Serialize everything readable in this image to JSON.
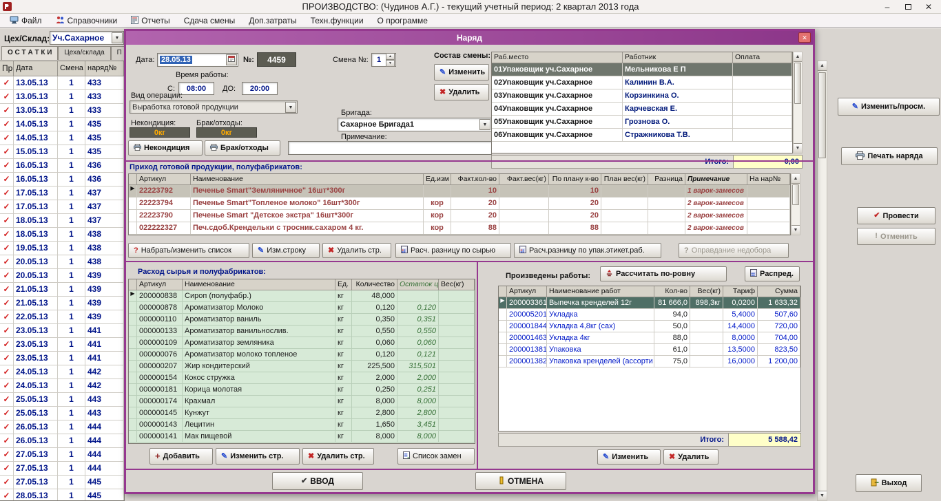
{
  "window": {
    "title": "ПРОИЗВОДСТВО:  (Чудинов А.Г.) - текущий учетный период: 2 квартал 2013 года"
  },
  "icons": {
    "minimize": "–",
    "close": "✕",
    "dialog_close": "✕",
    "check_dark": "✔",
    "check_red": "✔",
    "cross": "✖",
    "pencil": "✎",
    "question": "?",
    "plus": "+",
    "down": "▼",
    "up": "▲",
    "excl": "!"
  },
  "menu": {
    "items": [
      "Файл",
      "Справочники",
      "Отчеты",
      "Сдача смены",
      "Доп.затраты",
      "Техн.функции",
      "О программе"
    ]
  },
  "left_panel": {
    "workshop_label": "Цех/Склад:",
    "workshop_value": "Уч.Сахарное",
    "tabs": [
      "О С Т А Т К И",
      "Цеха/склада",
      "П Р"
    ],
    "columns": [
      "Пр.",
      "Дата",
      "Смена",
      "наряд№"
    ],
    "rows": [
      [
        "✓",
        "13.05.13",
        "1",
        "433"
      ],
      [
        "✓",
        "13.05.13",
        "1",
        "433"
      ],
      [
        "✓",
        "13.05.13",
        "1",
        "433"
      ],
      [
        "✓",
        "14.05.13",
        "1",
        "435"
      ],
      [
        "✓",
        "14.05.13",
        "1",
        "435"
      ],
      [
        "✓",
        "15.05.13",
        "1",
        "435"
      ],
      [
        "✓",
        "16.05.13",
        "1",
        "436"
      ],
      [
        "✓",
        "16.05.13",
        "1",
        "436"
      ],
      [
        "✓",
        "17.05.13",
        "1",
        "437"
      ],
      [
        "✓",
        "17.05.13",
        "1",
        "437"
      ],
      [
        "✓",
        "18.05.13",
        "1",
        "437"
      ],
      [
        "✓",
        "18.05.13",
        "1",
        "438"
      ],
      [
        "✓",
        "19.05.13",
        "1",
        "438"
      ],
      [
        "✓",
        "20.05.13",
        "1",
        "438"
      ],
      [
        "✓",
        "20.05.13",
        "1",
        "439"
      ],
      [
        "✓",
        "21.05.13",
        "1",
        "439"
      ],
      [
        "✓",
        "21.05.13",
        "1",
        "439"
      ],
      [
        "✓",
        "22.05.13",
        "1",
        "439"
      ],
      [
        "✓",
        "23.05.13",
        "1",
        "441"
      ],
      [
        "✓",
        "23.05.13",
        "1",
        "441"
      ],
      [
        "✓",
        "23.05.13",
        "1",
        "441"
      ],
      [
        "✓",
        "24.05.13",
        "1",
        "442"
      ],
      [
        "✓",
        "24.05.13",
        "1",
        "442"
      ],
      [
        "✓",
        "25.05.13",
        "1",
        "443"
      ],
      [
        "✓",
        "25.05.13",
        "1",
        "443"
      ],
      [
        "✓",
        "26.05.13",
        "1",
        "444"
      ],
      [
        "✓",
        "26.05.13",
        "1",
        "444"
      ],
      [
        "✓",
        "27.05.13",
        "1",
        "444"
      ],
      [
        "✓",
        "27.05.13",
        "1",
        "444"
      ],
      [
        "✓",
        "27.05.13",
        "1",
        "445"
      ],
      [
        "✓",
        "28.05.13",
        "1",
        "445"
      ]
    ]
  },
  "dialog": {
    "title": "Наряд",
    "form": {
      "date_label": "Дата:",
      "date_value": "28.05.13",
      "num_label": "№:",
      "num_value": "4459",
      "shift_label": "Смена №:",
      "shift_value": "1",
      "time_label": "Время работы:",
      "time_from_label": "С:",
      "time_from": "08:00",
      "time_to_label": "ДО:",
      "time_to": "20:00",
      "operation_label": "Вид операции:",
      "operation_value": "Выработка готовой продукции",
      "nekond_label": "Некондиция:",
      "nekond_value": "0кг",
      "brak_label": "Брак/отходы:",
      "brak_value": "0кг",
      "nekond_btn": "Некондиция",
      "brak_btn": "Брак/отходы",
      "brigade_label": "Бригада:",
      "brigade_value": "Сахарное Бригада1",
      "note_label": "Примечание:",
      "note_value": ""
    },
    "team": {
      "title": "Состав смены:",
      "edit_btn": "Изменить",
      "delete_btn": "Удалить",
      "columns": [
        "Раб.место",
        "Работник",
        "Оплата"
      ],
      "rows": [
        [
          "01Упаковщик уч.Сахарное",
          "Мельникова Е П",
          ""
        ],
        [
          "02Упаковщик уч.Сахарное",
          "Калинин В.А.",
          ""
        ],
        [
          "03Упаковщик уч.Сахарное",
          "Корзинкина О.",
          ""
        ],
        [
          "04Упаковщик уч.Сахарное",
          "Карчевская Е.",
          ""
        ],
        [
          "05Упаковщик уч.Сахарное",
          "Грознова О.",
          ""
        ],
        [
          "06Упаковщик уч.Сахарное",
          "Стражникова Т.В.",
          ""
        ]
      ],
      "total_label": "Итого:",
      "total_value": "0,00"
    },
    "prihod": {
      "title": "Приход готовой продукции, полуфабрикатов:",
      "columns": [
        "Артикул",
        "Наименование",
        "Ед.изм",
        "Факт.кол-во",
        "Факт.вес(кг)",
        "По плану к-во",
        "План вес(кг)",
        "Разница",
        "Примечание",
        "На нар№"
      ],
      "rows": [
        [
          "22223792",
          "Печенье  Smart\"Земляничное\" 16шт*300г",
          "",
          "10",
          "",
          "10",
          "",
          "",
          "1 варок-замесов",
          ""
        ],
        [
          "22223794",
          "Печенье  Smart\"Топленое молоко\" 16шт*300г",
          "кор",
          "20",
          "",
          "20",
          "",
          "",
          "2 варок-замесов",
          ""
        ],
        [
          "22223790",
          "Печенье Smart \"Детское экстра\" 16шт*300г",
          "кор",
          "20",
          "",
          "20",
          "",
          "",
          "2 варок-замесов",
          ""
        ],
        [
          "022222327",
          "Печ.сдоб.Крендельки с тросник.сахаром 4 кг.",
          "кор",
          "88",
          "",
          "88",
          "",
          "",
          "2 варок-замесов",
          ""
        ]
      ],
      "btn_list": "Набрать/изменить список",
      "btn_edit_row": "Изм.строку",
      "btn_del_row": "Удалить стр.",
      "btn_calc_raw": "Расч. разницу по сырью",
      "btn_calc_pack": "Расч.разницу по упак.этикет.раб.",
      "btn_justify": "Оправдание недобора"
    },
    "rashod": {
      "title": "Расход сырья и полуфабрикатов:",
      "columns": [
        "Артикул",
        "Наименование",
        "Ед.",
        "Количество",
        "Остаток ц.",
        "Вес(кг)"
      ],
      "rows": [
        [
          "200000838",
          "Сироп (полуфабр.)",
          "кг",
          "48,000",
          "",
          ""
        ],
        [
          "000000878",
          "Ароматизатор Молоко",
          "кг",
          "0,120",
          "0,120",
          ""
        ],
        [
          "000000110",
          "Ароматизатор ваниль",
          "кг",
          "0,350",
          "0,351",
          ""
        ],
        [
          "000000133",
          "Ароматизатор ванильнослив.",
          "кг",
          "0,550",
          "0,550",
          ""
        ],
        [
          "000000109",
          "Ароматизатор земляника",
          "кг",
          "0,060",
          "0,060",
          ""
        ],
        [
          "000000076",
          "Ароматизатор молоко топленое",
          "кг",
          "0,120",
          "0,121",
          ""
        ],
        [
          "000000207",
          "Жир кондитерский",
          "кг",
          "225,500",
          "315,501",
          ""
        ],
        [
          "000000154",
          "Кокос стружка",
          "кг",
          "2,000",
          "2,000",
          ""
        ],
        [
          "000000181",
          "Корица молотая",
          "кг",
          "0,250",
          "0,251",
          ""
        ],
        [
          "000000174",
          "Крахмал",
          "кг",
          "8,000",
          "8,000",
          ""
        ],
        [
          "000000145",
          "Кунжут",
          "кг",
          "2,800",
          "2,800",
          ""
        ],
        [
          "000000143",
          "Лецитин",
          "кг",
          "1,650",
          "3,451",
          ""
        ],
        [
          "000000141",
          "Мак пищевой",
          "кг",
          "8,000",
          "8,000",
          ""
        ]
      ],
      "btn_add": "Добавить",
      "btn_edit": "Изменить стр.",
      "btn_del": "Удалить стр.",
      "btn_subst": "Список замен"
    },
    "works": {
      "title": "Произведены работы:",
      "btn_equal": "Рассчитать по-ровну",
      "btn_distr": "Распред.",
      "columns": [
        "Артикул",
        "Наименование работ",
        "Кол-во",
        "Вес(кг)",
        "Тариф",
        "Сумма"
      ],
      "rows": [
        [
          "200003361",
          "Выпечка кренделей 12г",
          "81 666,0",
          "898,3кг",
          "0,0200",
          "1 633,32"
        ],
        [
          "200005201",
          "Укладка",
          "94,0",
          "",
          "5,4000",
          "507,60"
        ],
        [
          "200001844",
          "Укладка 4,8кг (сах)",
          "50,0",
          "",
          "14,4000",
          "720,00"
        ],
        [
          "200001463",
          "Укладка 4кг",
          "88,0",
          "",
          "8,0000",
          "704,00"
        ],
        [
          "200001381",
          "Упаковка",
          "61,0",
          "",
          "13,5000",
          "823,50"
        ],
        [
          "200001382",
          "Упаковка кренделей (ассорти",
          "75,0",
          "",
          "16,0000",
          "1 200,00"
        ]
      ],
      "total_label": "Итого:",
      "total_value": "5 588,42",
      "btn_edit": "Изменить",
      "btn_del": "Удалить"
    },
    "footer": {
      "ok_btn": "ВВОД",
      "cancel_btn": "ОТМЕНА"
    }
  },
  "right_panel": {
    "edit_view_btn": "Изменить/просм.",
    "print_btn": "Печать наряда",
    "post_btn": "Провести",
    "unpost_btn": "Отменить",
    "exit_btn": "Выход"
  }
}
